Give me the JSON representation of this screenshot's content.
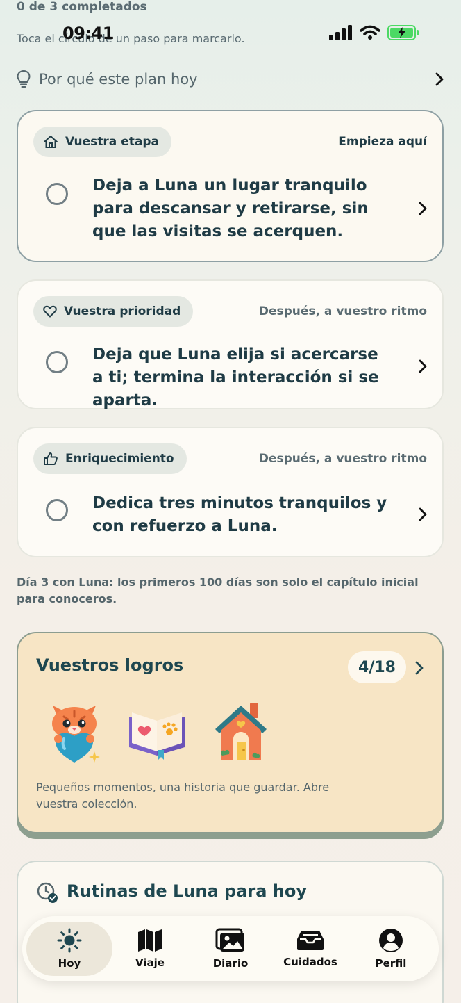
{
  "header": {
    "progress": "0 de 3 completados",
    "hint": "Toca el círculo de un paso para marcarlo.",
    "time": "09:41"
  },
  "why_plan": {
    "label": "Por qué este plan hoy"
  },
  "steps": [
    {
      "chip": "Vuestra etapa",
      "chip_icon": "home-icon",
      "tag": "Empieza aquí",
      "text": "Deja a Luna un lugar tranquilo para descansar y retirarse, sin que las visitas se acerquen."
    },
    {
      "chip": "Vuestra prioridad",
      "chip_icon": "heart-icon",
      "tag": "Después, a vuestro ritmo",
      "text": "Deja que Luna elija si acercarse a ti; termina la interacción si se aparta."
    },
    {
      "chip": "Enriquecimiento",
      "chip_icon": "thumbs-up-icon",
      "tag": "Después, a vuestro ritmo",
      "text": "Dedica tres minutos tranquilos y con refuerzo a Luna."
    }
  ],
  "day_note": "Día 3 con Luna: los primeros 100 días son solo el capítulo inicial para conoceros.",
  "achievements": {
    "title": "Vuestros logros",
    "count": "4/18",
    "description": "Pequeños momentos, una historia que guardar. Abre vuestra colección."
  },
  "routines": {
    "title": "Rutinas de Luna para hoy"
  },
  "tabs": [
    {
      "label": "Hoy",
      "icon": "sun-icon",
      "active": true
    },
    {
      "label": "Viaje",
      "icon": "map-icon"
    },
    {
      "label": "Diario",
      "icon": "photo-icon"
    },
    {
      "label": "Cuidados",
      "icon": "inbox-icon"
    },
    {
      "label": "Perfil",
      "icon": "person-icon"
    }
  ],
  "colors": {
    "accent": "#1e4750",
    "achievement_bg": "#f7e5c5",
    "battery": "#4cd964"
  }
}
